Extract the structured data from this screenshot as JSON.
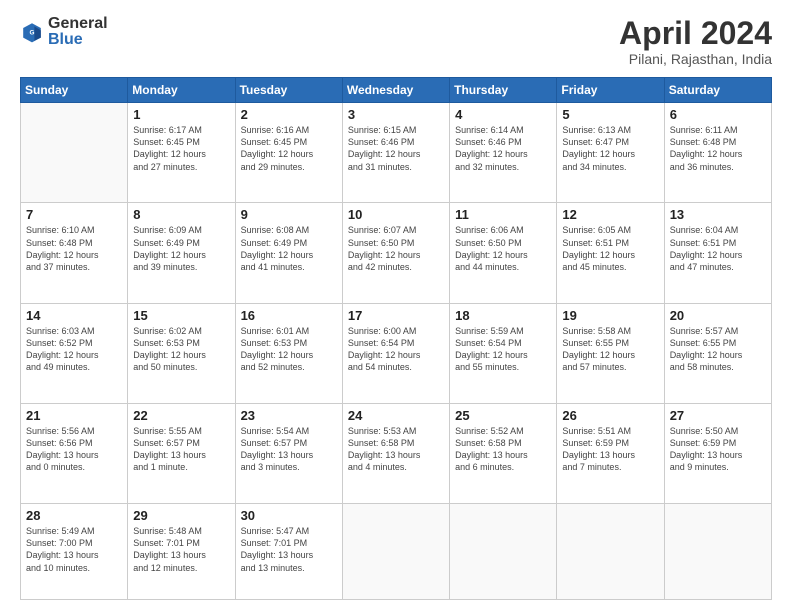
{
  "logo": {
    "general": "General",
    "blue": "Blue"
  },
  "header": {
    "title": "April 2024",
    "subtitle": "Pilani, Rajasthan, India"
  },
  "columns": [
    "Sunday",
    "Monday",
    "Tuesday",
    "Wednesday",
    "Thursday",
    "Friday",
    "Saturday"
  ],
  "weeks": [
    [
      {
        "day": "",
        "text": ""
      },
      {
        "day": "1",
        "text": "Sunrise: 6:17 AM\nSunset: 6:45 PM\nDaylight: 12 hours\nand 27 minutes."
      },
      {
        "day": "2",
        "text": "Sunrise: 6:16 AM\nSunset: 6:45 PM\nDaylight: 12 hours\nand 29 minutes."
      },
      {
        "day": "3",
        "text": "Sunrise: 6:15 AM\nSunset: 6:46 PM\nDaylight: 12 hours\nand 31 minutes."
      },
      {
        "day": "4",
        "text": "Sunrise: 6:14 AM\nSunset: 6:46 PM\nDaylight: 12 hours\nand 32 minutes."
      },
      {
        "day": "5",
        "text": "Sunrise: 6:13 AM\nSunset: 6:47 PM\nDaylight: 12 hours\nand 34 minutes."
      },
      {
        "day": "6",
        "text": "Sunrise: 6:11 AM\nSunset: 6:48 PM\nDaylight: 12 hours\nand 36 minutes."
      }
    ],
    [
      {
        "day": "7",
        "text": "Sunrise: 6:10 AM\nSunset: 6:48 PM\nDaylight: 12 hours\nand 37 minutes."
      },
      {
        "day": "8",
        "text": "Sunrise: 6:09 AM\nSunset: 6:49 PM\nDaylight: 12 hours\nand 39 minutes."
      },
      {
        "day": "9",
        "text": "Sunrise: 6:08 AM\nSunset: 6:49 PM\nDaylight: 12 hours\nand 41 minutes."
      },
      {
        "day": "10",
        "text": "Sunrise: 6:07 AM\nSunset: 6:50 PM\nDaylight: 12 hours\nand 42 minutes."
      },
      {
        "day": "11",
        "text": "Sunrise: 6:06 AM\nSunset: 6:50 PM\nDaylight: 12 hours\nand 44 minutes."
      },
      {
        "day": "12",
        "text": "Sunrise: 6:05 AM\nSunset: 6:51 PM\nDaylight: 12 hours\nand 45 minutes."
      },
      {
        "day": "13",
        "text": "Sunrise: 6:04 AM\nSunset: 6:51 PM\nDaylight: 12 hours\nand 47 minutes."
      }
    ],
    [
      {
        "day": "14",
        "text": "Sunrise: 6:03 AM\nSunset: 6:52 PM\nDaylight: 12 hours\nand 49 minutes."
      },
      {
        "day": "15",
        "text": "Sunrise: 6:02 AM\nSunset: 6:53 PM\nDaylight: 12 hours\nand 50 minutes."
      },
      {
        "day": "16",
        "text": "Sunrise: 6:01 AM\nSunset: 6:53 PM\nDaylight: 12 hours\nand 52 minutes."
      },
      {
        "day": "17",
        "text": "Sunrise: 6:00 AM\nSunset: 6:54 PM\nDaylight: 12 hours\nand 54 minutes."
      },
      {
        "day": "18",
        "text": "Sunrise: 5:59 AM\nSunset: 6:54 PM\nDaylight: 12 hours\nand 55 minutes."
      },
      {
        "day": "19",
        "text": "Sunrise: 5:58 AM\nSunset: 6:55 PM\nDaylight: 12 hours\nand 57 minutes."
      },
      {
        "day": "20",
        "text": "Sunrise: 5:57 AM\nSunset: 6:55 PM\nDaylight: 12 hours\nand 58 minutes."
      }
    ],
    [
      {
        "day": "21",
        "text": "Sunrise: 5:56 AM\nSunset: 6:56 PM\nDaylight: 13 hours\nand 0 minutes."
      },
      {
        "day": "22",
        "text": "Sunrise: 5:55 AM\nSunset: 6:57 PM\nDaylight: 13 hours\nand 1 minute."
      },
      {
        "day": "23",
        "text": "Sunrise: 5:54 AM\nSunset: 6:57 PM\nDaylight: 13 hours\nand 3 minutes."
      },
      {
        "day": "24",
        "text": "Sunrise: 5:53 AM\nSunset: 6:58 PM\nDaylight: 13 hours\nand 4 minutes."
      },
      {
        "day": "25",
        "text": "Sunrise: 5:52 AM\nSunset: 6:58 PM\nDaylight: 13 hours\nand 6 minutes."
      },
      {
        "day": "26",
        "text": "Sunrise: 5:51 AM\nSunset: 6:59 PM\nDaylight: 13 hours\nand 7 minutes."
      },
      {
        "day": "27",
        "text": "Sunrise: 5:50 AM\nSunset: 6:59 PM\nDaylight: 13 hours\nand 9 minutes."
      }
    ],
    [
      {
        "day": "28",
        "text": "Sunrise: 5:49 AM\nSunset: 7:00 PM\nDaylight: 13 hours\nand 10 minutes."
      },
      {
        "day": "29",
        "text": "Sunrise: 5:48 AM\nSunset: 7:01 PM\nDaylight: 13 hours\nand 12 minutes."
      },
      {
        "day": "30",
        "text": "Sunrise: 5:47 AM\nSunset: 7:01 PM\nDaylight: 13 hours\nand 13 minutes."
      },
      {
        "day": "",
        "text": ""
      },
      {
        "day": "",
        "text": ""
      },
      {
        "day": "",
        "text": ""
      },
      {
        "day": "",
        "text": ""
      }
    ]
  ]
}
